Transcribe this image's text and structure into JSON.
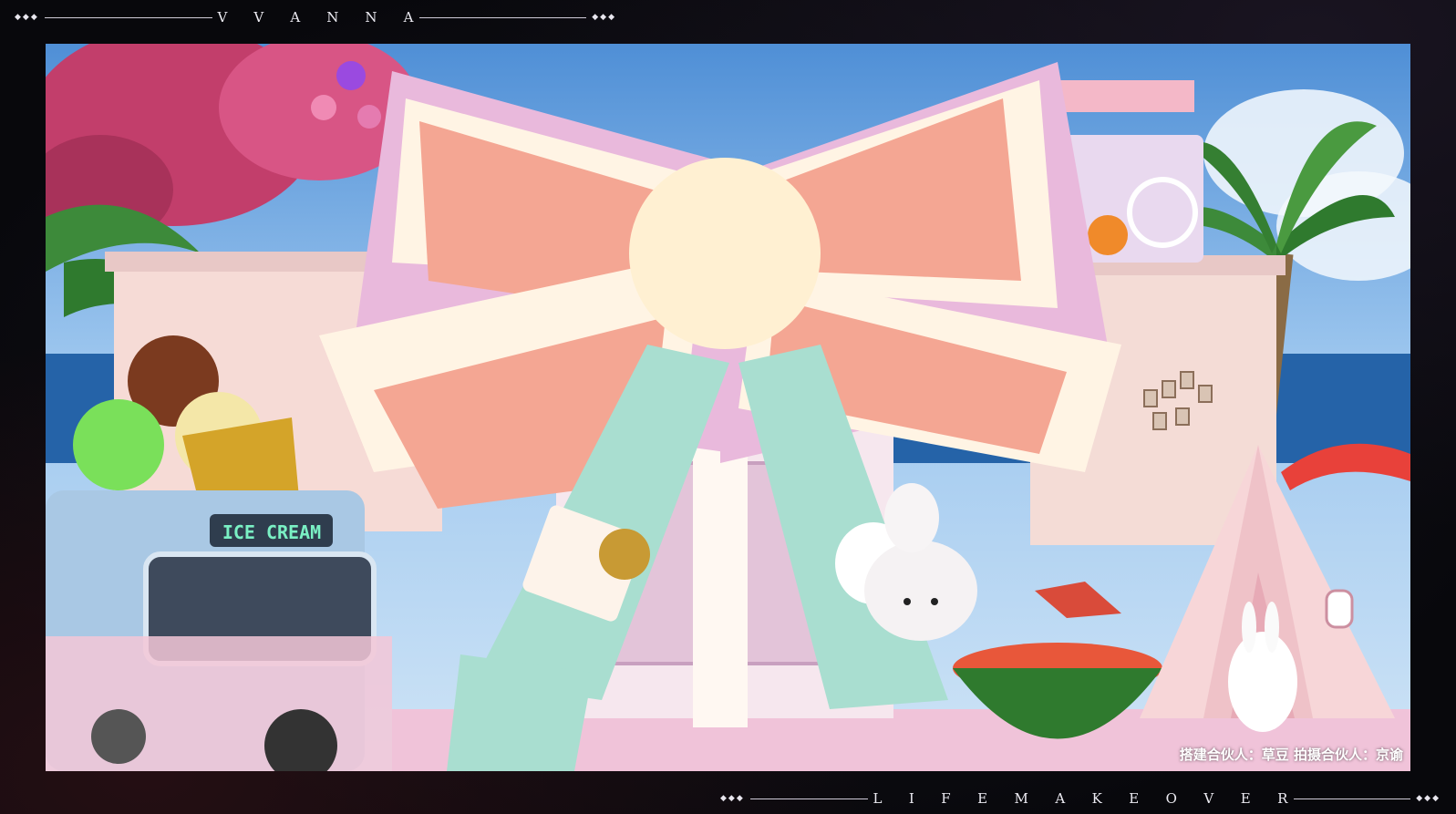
{
  "header": {
    "title": "VVANNA",
    "leading_dots": "◆◆◆",
    "trailing_dots": "◆◆◆"
  },
  "footer": {
    "title": "LIFEMAKEOVER",
    "leading_dots": "◆◆◆",
    "trailing_dots": "◆◆◆"
  },
  "scene": {
    "sign_text": "ICE CREAM",
    "caption": "搭建合伙人：草豆 拍摄合伙人：京谕"
  },
  "colors": {
    "bow_coral": "#f4a693",
    "bow_pink": "#e9b9dc",
    "bow_cream": "#fff4e4",
    "ribbon_mint": "#a9ded0",
    "truck_blue": "#a9c8e4",
    "tree_pink": "#c23e6b",
    "palm_green": "#3d8a3a",
    "sea_blue": "#2563a8"
  }
}
